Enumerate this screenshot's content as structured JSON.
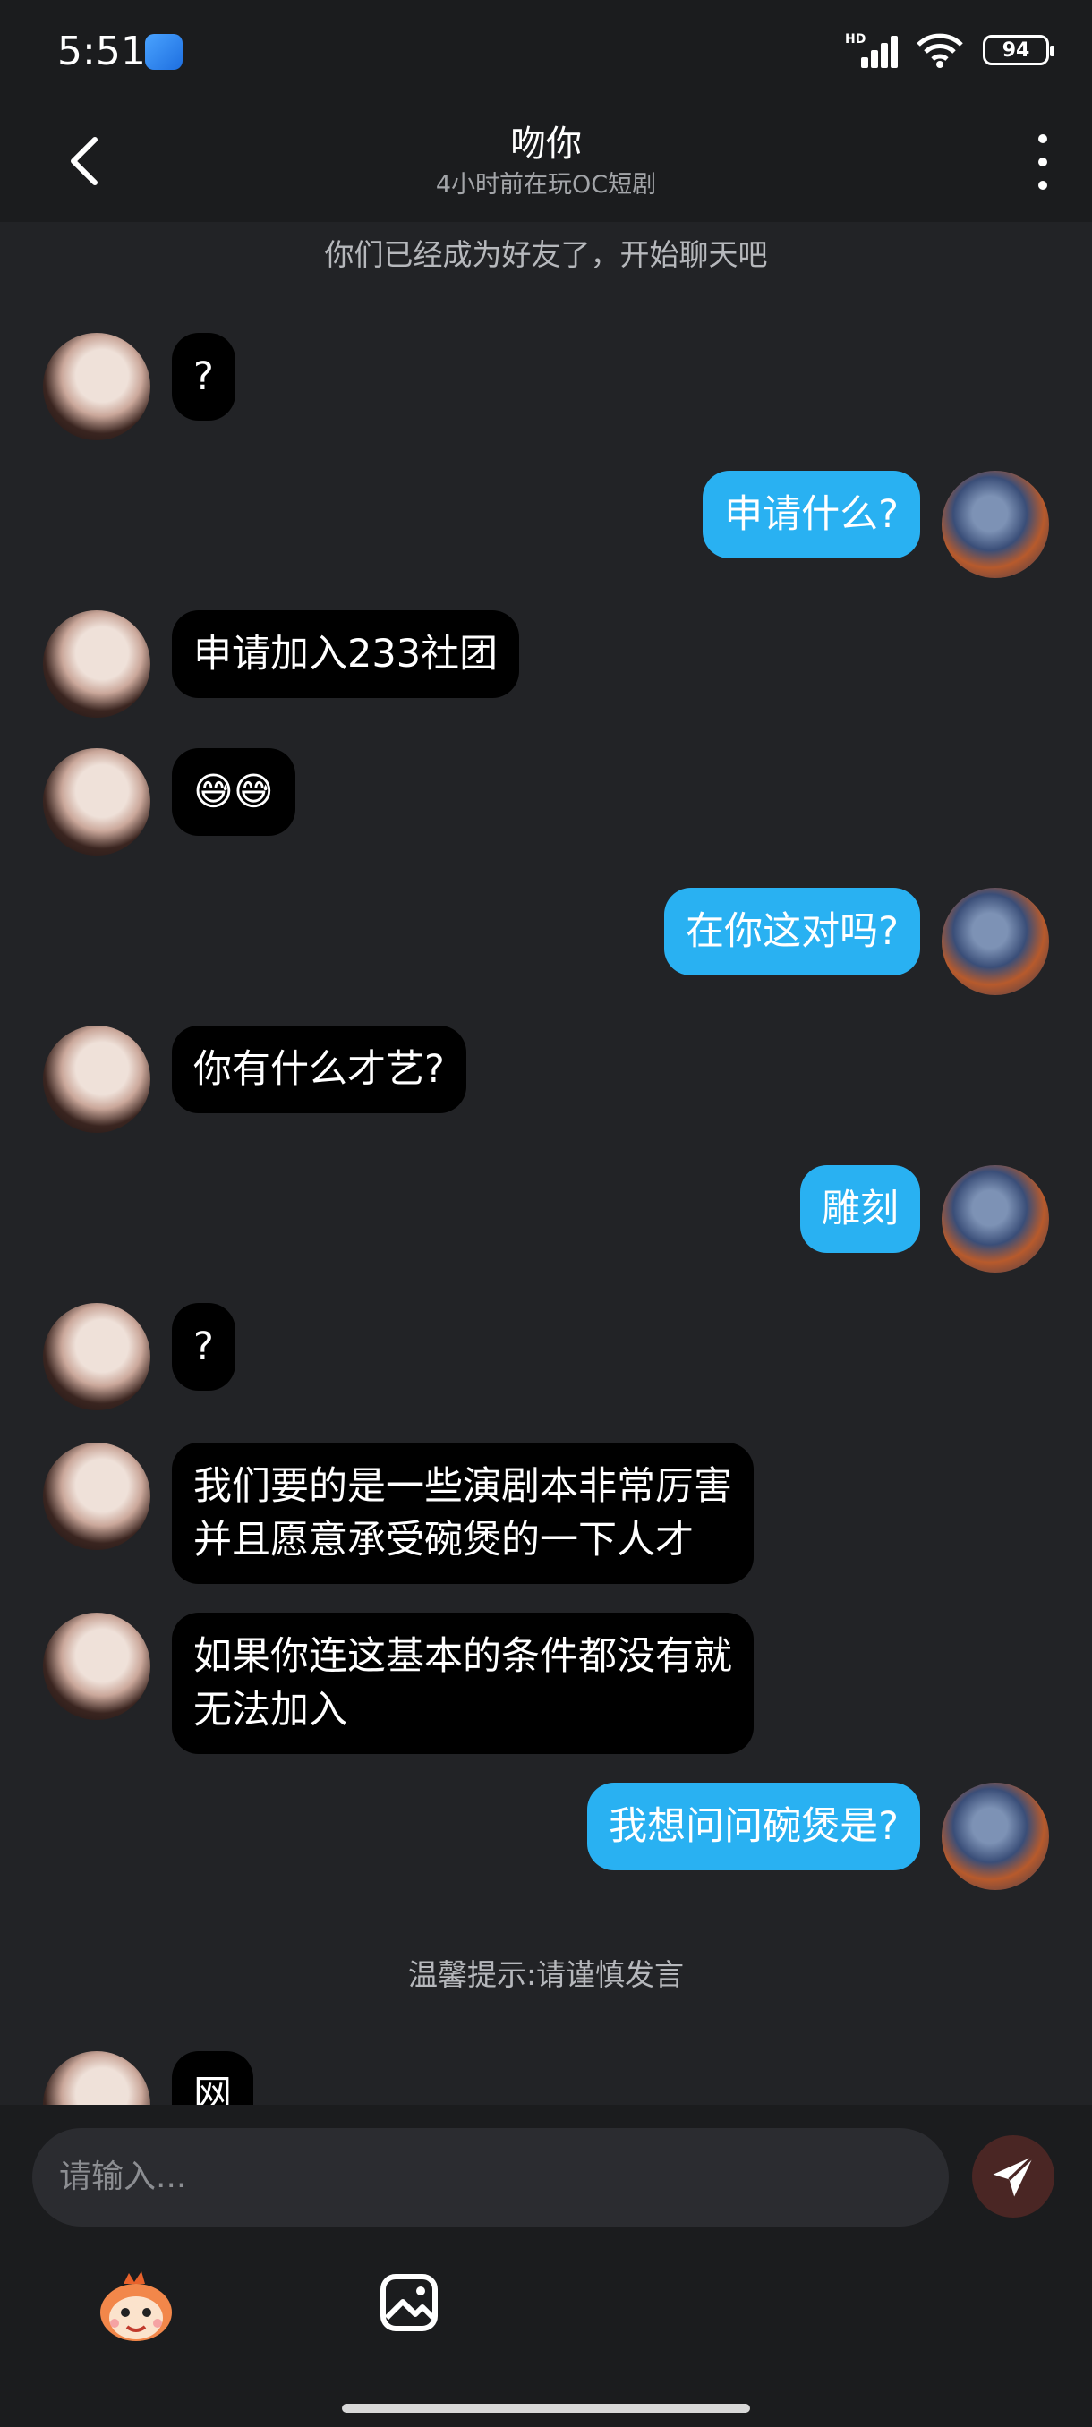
{
  "status_bar": {
    "time": "5:51",
    "network_badge": "HD",
    "battery": "94"
  },
  "header": {
    "title": "吻你",
    "subtitle": "4小时前在玩OC短剧"
  },
  "system_messages": {
    "friend_notice": "你们已经成为好友了，开始聊天吧",
    "warning": "温馨提示:请谨慎发言"
  },
  "messages": [
    {
      "side": "left",
      "text": "?"
    },
    {
      "side": "right",
      "text": "申请什么?"
    },
    {
      "side": "left",
      "text": "申请加入233社团"
    },
    {
      "side": "left",
      "text": "😅😅"
    },
    {
      "side": "right",
      "text": "在你这对吗?"
    },
    {
      "side": "left",
      "text": "你有什么才艺?"
    },
    {
      "side": "right",
      "text": "雕刻"
    },
    {
      "side": "left",
      "text": "?"
    },
    {
      "side": "left",
      "text": "我们要的是一些演剧本非常厉害\n并且愿意承受碗煲的一下人才"
    },
    {
      "side": "left",
      "text": "如果你连这基本的条件都没有就\n无法加入"
    },
    {
      "side": "right",
      "text": "我想问问碗煲是?"
    },
    {
      "side": "left",
      "text": "网"
    }
  ],
  "input": {
    "placeholder": "请输入..."
  },
  "icons": {
    "back": "chevron-left-icon",
    "more": "more-vertical-icon",
    "send": "paper-plane-icon",
    "emoji": "mascot-emoji-icon",
    "image": "image-icon"
  },
  "colors": {
    "outgoing_bubble": "#29b1f2",
    "incoming_bubble": "#000000",
    "background": "#222326",
    "send_button": "#4a2624"
  }
}
